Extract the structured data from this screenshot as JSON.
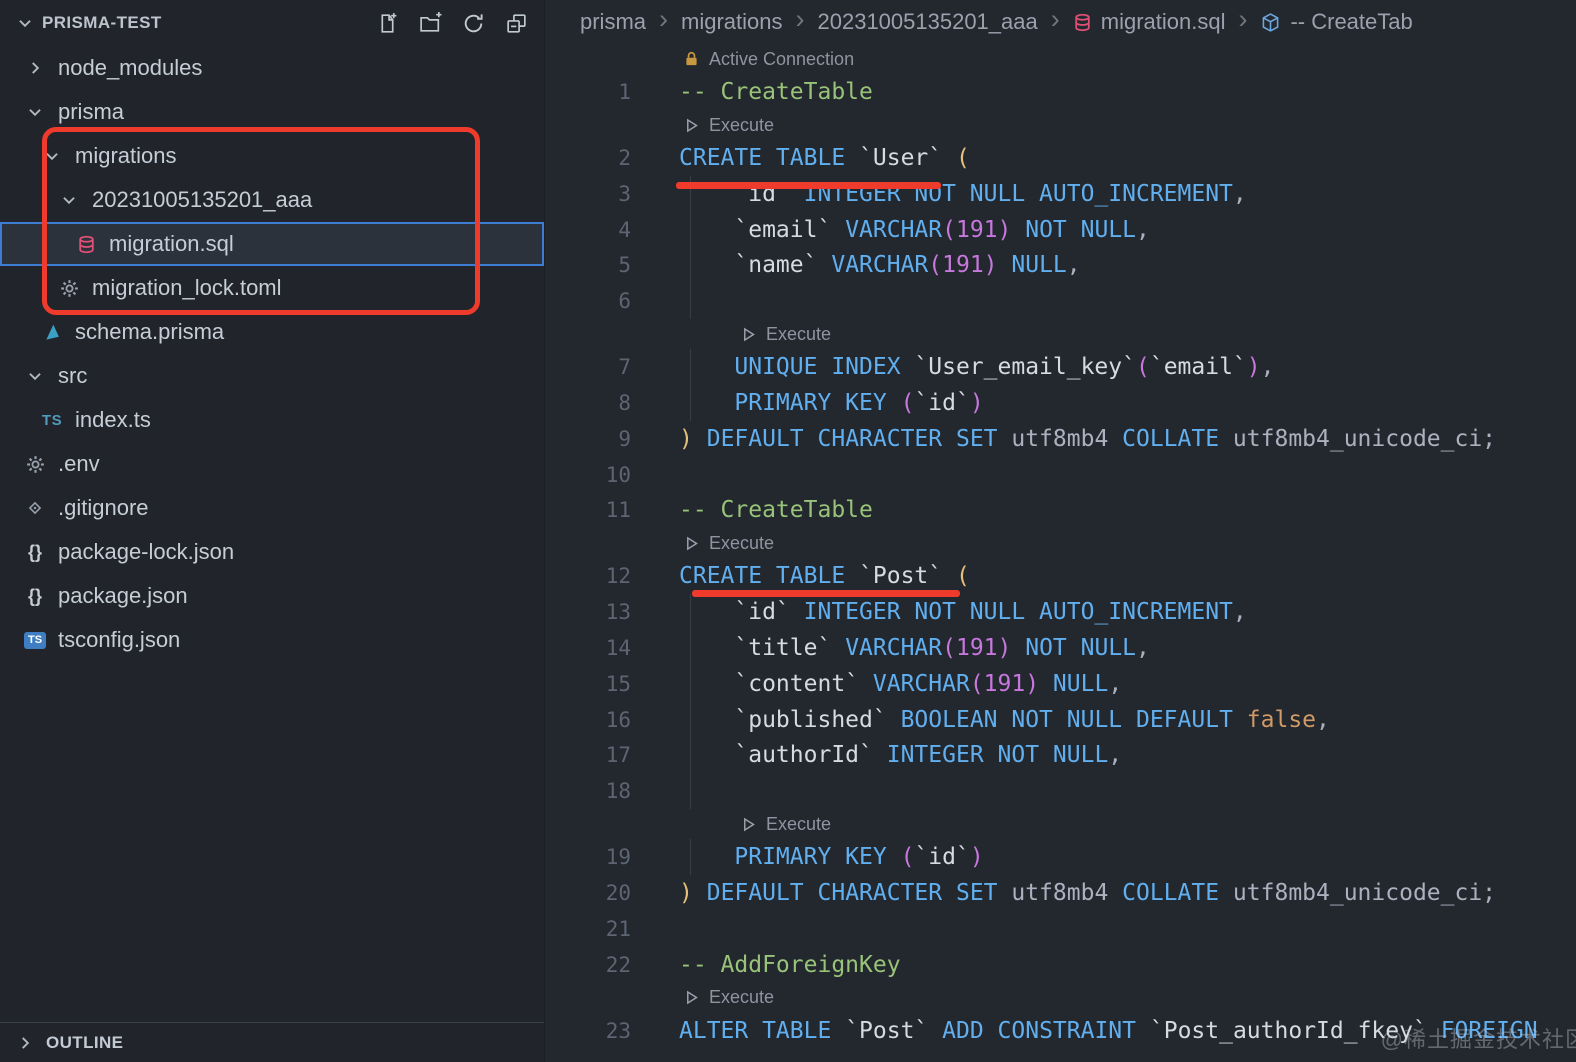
{
  "window": {
    "watermark": "@稀土掘金技术社区"
  },
  "colors": {
    "annotation_red": "#ee3b2b",
    "selection_blue": "#3e7bd2",
    "comment_green": "#98c379",
    "keyword_blue": "#61afef",
    "identifier_white": "#d7dae0",
    "bracket_gold": "#e5c07b",
    "bracket_magenta": "#c678dd",
    "literal_orange": "#d19a66",
    "default_text": "#abb2bf"
  },
  "sidebar": {
    "title": "PRISMA-TEST",
    "toolbar": [
      {
        "icon": "file-plus",
        "name": "new-file"
      },
      {
        "icon": "folder-plus",
        "name": "new-folder"
      },
      {
        "icon": "refresh",
        "name": "refresh-explorer"
      },
      {
        "icon": "collapse",
        "name": "collapse-folders"
      }
    ],
    "items": [
      {
        "label": "node_modules",
        "indent": 0,
        "icon": "chevron-right"
      },
      {
        "label": "prisma",
        "indent": 0,
        "icon": "chevron-down"
      },
      {
        "label": "migrations",
        "indent": 1,
        "icon": "chevron-down"
      },
      {
        "label": "20231005135201_aaa",
        "indent": 2,
        "icon": "chevron-down"
      },
      {
        "label": "migration.sql",
        "indent": 3,
        "icon": "database",
        "selected": true
      },
      {
        "label": "migration_lock.toml",
        "indent": 2,
        "icon": "gear"
      },
      {
        "label": "schema.prisma",
        "indent": 1,
        "icon": "prisma"
      },
      {
        "label": "src",
        "indent": 0,
        "icon": "chevron-down"
      },
      {
        "label": "index.ts",
        "indent": 1,
        "icon": "ts"
      },
      {
        "label": ".env",
        "indent": 0,
        "icon": "gear"
      },
      {
        "label": ".gitignore",
        "indent": 0,
        "icon": "git-diamond"
      },
      {
        "label": "package-lock.json",
        "indent": 0,
        "icon": "braces"
      },
      {
        "label": "package.json",
        "indent": 0,
        "icon": "braces"
      },
      {
        "label": "tsconfig.json",
        "indent": 0,
        "icon": "ts-badge"
      }
    ],
    "outline_label": "OUTLINE"
  },
  "breadcrumb": [
    {
      "label": "prisma"
    },
    {
      "label": "migrations"
    },
    {
      "label": "20231005135201_aaa"
    },
    {
      "label": "migration.sql",
      "icon": "database"
    },
    {
      "label": "-- CreateTab",
      "icon": "cube"
    }
  ],
  "editor": {
    "rows": [
      {
        "type": "lens",
        "icon": "lock",
        "label": "Active Connection",
        "indent": 0
      },
      {
        "type": "code",
        "n": 1,
        "tokens": [
          [
            "cm",
            "-- CreateTable"
          ]
        ]
      },
      {
        "type": "lens",
        "icon": "play",
        "label": "Execute",
        "indent": 0
      },
      {
        "type": "code",
        "n": 2,
        "tokens": [
          [
            "kw",
            "CREATE TABLE"
          ],
          [
            "tx",
            " "
          ],
          [
            "id",
            "`User`"
          ],
          [
            "tx",
            " "
          ],
          [
            "b1",
            "("
          ]
        ]
      },
      {
        "type": "code",
        "n": 3,
        "g": 1,
        "tokens": [
          [
            "tx",
            "    "
          ],
          [
            "id",
            "`id`"
          ],
          [
            "tx",
            " "
          ],
          [
            "kw",
            "INTEGER NOT NULL AUTO_INCREMENT"
          ],
          [
            "tx",
            ","
          ]
        ]
      },
      {
        "type": "code",
        "n": 4,
        "g": 1,
        "tokens": [
          [
            "tx",
            "    "
          ],
          [
            "id",
            "`email`"
          ],
          [
            "tx",
            " "
          ],
          [
            "kw",
            "VARCHAR"
          ],
          [
            "b2",
            "(191)"
          ],
          [
            "tx",
            " "
          ],
          [
            "kw",
            "NOT NULL"
          ],
          [
            "tx",
            ","
          ]
        ]
      },
      {
        "type": "code",
        "n": 5,
        "g": 1,
        "tokens": [
          [
            "tx",
            "    "
          ],
          [
            "id",
            "`name`"
          ],
          [
            "tx",
            " "
          ],
          [
            "kw",
            "VARCHAR"
          ],
          [
            "b2",
            "(191)"
          ],
          [
            "tx",
            " "
          ],
          [
            "kw",
            "NULL"
          ],
          [
            "tx",
            ","
          ]
        ]
      },
      {
        "type": "code",
        "n": 6,
        "g": 1,
        "tokens": []
      },
      {
        "type": "lens",
        "icon": "play",
        "label": "Execute",
        "indent": 1
      },
      {
        "type": "code",
        "n": 7,
        "g": 1,
        "tokens": [
          [
            "tx",
            "    "
          ],
          [
            "kw",
            "UNIQUE INDEX"
          ],
          [
            "tx",
            " "
          ],
          [
            "id",
            "`User_email_key`"
          ],
          [
            "b2",
            "("
          ],
          [
            "id",
            "`email`"
          ],
          [
            "b2",
            ")"
          ],
          [
            "tx",
            ","
          ]
        ]
      },
      {
        "type": "code",
        "n": 8,
        "g": 1,
        "tokens": [
          [
            "tx",
            "    "
          ],
          [
            "kw",
            "PRIMARY KEY"
          ],
          [
            "tx",
            " "
          ],
          [
            "b2",
            "("
          ],
          [
            "id",
            "`id`"
          ],
          [
            "b2",
            ")"
          ]
        ]
      },
      {
        "type": "code",
        "n": 9,
        "tokens": [
          [
            "b1",
            ")"
          ],
          [
            "tx",
            " "
          ],
          [
            "kw",
            "DEFAULT CHARACTER SET"
          ],
          [
            "tx",
            " utf8mb4 "
          ],
          [
            "kw",
            "COLLATE"
          ],
          [
            "tx",
            " utf8mb4_unicode_ci;"
          ]
        ]
      },
      {
        "type": "code",
        "n": 10,
        "tokens": []
      },
      {
        "type": "code",
        "n": 11,
        "tokens": [
          [
            "cm",
            "-- CreateTable"
          ]
        ]
      },
      {
        "type": "lens",
        "icon": "play",
        "label": "Execute",
        "indent": 0
      },
      {
        "type": "code",
        "n": 12,
        "tokens": [
          [
            "kw",
            "CREATE TABLE"
          ],
          [
            "tx",
            " "
          ],
          [
            "id",
            "`Post`"
          ],
          [
            "tx",
            " "
          ],
          [
            "b1",
            "("
          ]
        ]
      },
      {
        "type": "code",
        "n": 13,
        "g": 1,
        "tokens": [
          [
            "tx",
            "    "
          ],
          [
            "id",
            "`id`"
          ],
          [
            "tx",
            " "
          ],
          [
            "kw",
            "INTEGER NOT NULL AUTO_INCREMENT"
          ],
          [
            "tx",
            ","
          ]
        ]
      },
      {
        "type": "code",
        "n": 14,
        "g": 1,
        "tokens": [
          [
            "tx",
            "    "
          ],
          [
            "id",
            "`title`"
          ],
          [
            "tx",
            " "
          ],
          [
            "kw",
            "VARCHAR"
          ],
          [
            "b2",
            "(191)"
          ],
          [
            "tx",
            " "
          ],
          [
            "kw",
            "NOT NULL"
          ],
          [
            "tx",
            ","
          ]
        ]
      },
      {
        "type": "code",
        "n": 15,
        "g": 1,
        "tokens": [
          [
            "tx",
            "    "
          ],
          [
            "id",
            "`content`"
          ],
          [
            "tx",
            " "
          ],
          [
            "kw",
            "VARCHAR"
          ],
          [
            "b2",
            "(191)"
          ],
          [
            "tx",
            " "
          ],
          [
            "kw",
            "NULL"
          ],
          [
            "tx",
            ","
          ]
        ]
      },
      {
        "type": "code",
        "n": 16,
        "g": 1,
        "tokens": [
          [
            "tx",
            "    "
          ],
          [
            "id",
            "`published`"
          ],
          [
            "tx",
            " "
          ],
          [
            "kw",
            "BOOLEAN NOT NULL DEFAULT"
          ],
          [
            "tx",
            " "
          ],
          [
            "lit",
            "false"
          ],
          [
            "tx",
            ","
          ]
        ]
      },
      {
        "type": "code",
        "n": 17,
        "g": 1,
        "tokens": [
          [
            "tx",
            "    "
          ],
          [
            "id",
            "`authorId`"
          ],
          [
            "tx",
            " "
          ],
          [
            "kw",
            "INTEGER NOT NULL"
          ],
          [
            "tx",
            ","
          ]
        ]
      },
      {
        "type": "code",
        "n": 18,
        "g": 1,
        "tokens": []
      },
      {
        "type": "lens",
        "icon": "play",
        "label": "Execute",
        "indent": 1
      },
      {
        "type": "code",
        "n": 19,
        "g": 1,
        "tokens": [
          [
            "tx",
            "    "
          ],
          [
            "kw",
            "PRIMARY KEY"
          ],
          [
            "tx",
            " "
          ],
          [
            "b2",
            "("
          ],
          [
            "id",
            "`id`"
          ],
          [
            "b2",
            ")"
          ]
        ]
      },
      {
        "type": "code",
        "n": 20,
        "tokens": [
          [
            "b1",
            ")"
          ],
          [
            "tx",
            " "
          ],
          [
            "kw",
            "DEFAULT CHARACTER SET"
          ],
          [
            "tx",
            " utf8mb4 "
          ],
          [
            "kw",
            "COLLATE"
          ],
          [
            "tx",
            " utf8mb4_unicode_ci;"
          ]
        ]
      },
      {
        "type": "code",
        "n": 21,
        "tokens": []
      },
      {
        "type": "code",
        "n": 22,
        "tokens": [
          [
            "cm",
            "-- AddForeignKey"
          ]
        ]
      },
      {
        "type": "lens",
        "icon": "play",
        "label": "Execute",
        "indent": 0
      },
      {
        "type": "code",
        "n": 23,
        "tokens": [
          [
            "kw",
            "ALTER TABLE"
          ],
          [
            "tx",
            " "
          ],
          [
            "id",
            "`Post`"
          ],
          [
            "tx",
            " "
          ],
          [
            "kw",
            "ADD CONSTRAINT"
          ],
          [
            "tx",
            " "
          ],
          [
            "id",
            "`Post_authorId_fkey`"
          ],
          [
            "tx",
            " "
          ],
          [
            "kw",
            "FOREIGN"
          ]
        ]
      }
    ]
  }
}
